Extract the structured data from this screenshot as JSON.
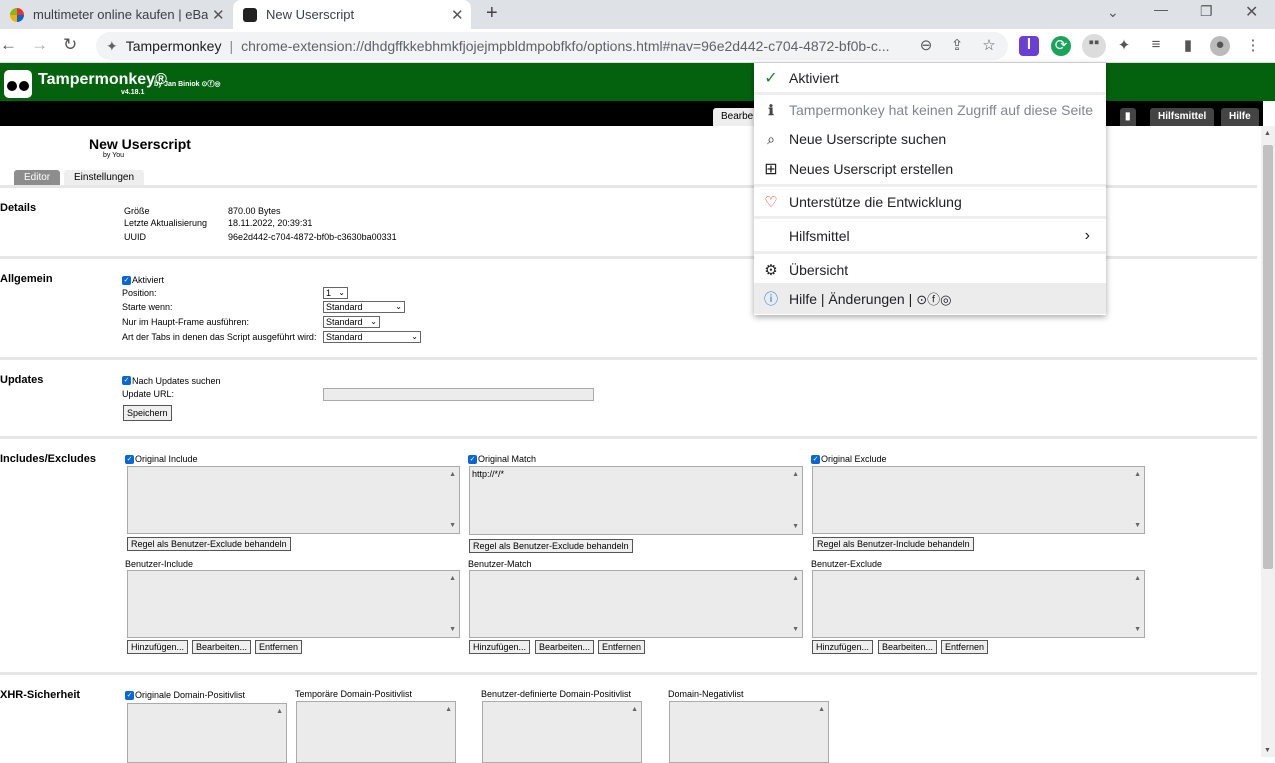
{
  "browser": {
    "tabs": [
      {
        "title": "multimeter online kaufen | eBay"
      },
      {
        "title": "New Userscript"
      }
    ],
    "omnibox": {
      "ext_name": "Tampermonkey",
      "url": "chrome-extension://dhdgffkkebhmkfjojejmpbldmpobfkfo/options.html#nav=96e2d442-c704-4872-bf0b-c..."
    }
  },
  "tm": {
    "title": "Tampermonkey®",
    "by": "by Jan Biniok",
    "version": "v4.18.1",
    "header_tabs": [
      "Bearbe",
      "Hilfsmittel",
      "Hilfe"
    ]
  },
  "script": {
    "title": "New Userscript",
    "by": "by You",
    "subtabs": [
      "Editor",
      "Einstellungen"
    ]
  },
  "details": {
    "heading": "Details",
    "rows": [
      {
        "label": "Größe",
        "value": "870.00 Bytes"
      },
      {
        "label": "Letzte Aktualisierung",
        "value": "18.11.2022, 20:39:31"
      },
      {
        "label": "UUID",
        "value": "96e2d442-c704-4872-bf0b-c3630ba00331"
      }
    ]
  },
  "allgemein": {
    "heading": "Allgemein",
    "aktiviert": "Aktiviert",
    "position_label": "Position:",
    "position_value": "1",
    "starte_label": "Starte wenn:",
    "starte_value": "Standard",
    "frame_label": "Nur im Haupt-Frame ausführen:",
    "frame_value": "Standard",
    "tabs_label": "Art der Tabs in denen das Script ausgeführt wird:",
    "tabs_value": "Standard"
  },
  "updates": {
    "heading": "Updates",
    "check_label": "Nach Updates suchen",
    "url_label": "Update URL:",
    "save": "Speichern"
  },
  "includes": {
    "heading": "Includes/Excludes",
    "col1": {
      "check": "Original Include",
      "btn": "Regel als Benutzer-Exclude behandeln",
      "user_label": "Benutzer-Include"
    },
    "col2": {
      "check": "Original Match",
      "value": "http://*/*",
      "btn": "Regel als Benutzer-Exclude behandeln",
      "user_label": "Benutzer-Match"
    },
    "col3": {
      "check": "Original Exclude",
      "btn": "Regel als Benutzer-Include behandeln",
      "user_label": "Benutzer-Exclude"
    },
    "add": "Hinzufügen...",
    "edit": "Bearbeiten...",
    "remove": "Entfernen"
  },
  "xhr": {
    "heading": "XHR-Sicherheit",
    "col1": "Originale Domain-Positivlist",
    "col2": "Temporäre Domain-Positivlist",
    "col3": "Benutzer-definierte Domain-Positivlist",
    "col4": "Domain-Negativlist"
  },
  "menu": {
    "items": [
      {
        "label": "Aktiviert",
        "icon": "check-icon"
      },
      {
        "label": "Tampermonkey hat keinen Zugriff auf diese Seite",
        "icon": "info-i-icon"
      },
      {
        "label": "Neue Userscripte suchen",
        "icon": "search-icon"
      },
      {
        "label": "Neues Userscript erstellen",
        "icon": "plus-box-icon"
      },
      {
        "label": "Unterstütze die Entwicklung",
        "icon": "heart-icon"
      },
      {
        "label": "Hilfsmittel",
        "icon": "chevron-right-icon"
      },
      {
        "label": "Übersicht",
        "icon": "gear-icon"
      },
      {
        "label": "Hilfe | Änderungen |",
        "icon": "info-circle-icon"
      }
    ]
  },
  "colors": {
    "tm_green": "#04620f",
    "menu_check": "#1e7e34",
    "heart": "#d93025",
    "info": "#1a73e8"
  }
}
